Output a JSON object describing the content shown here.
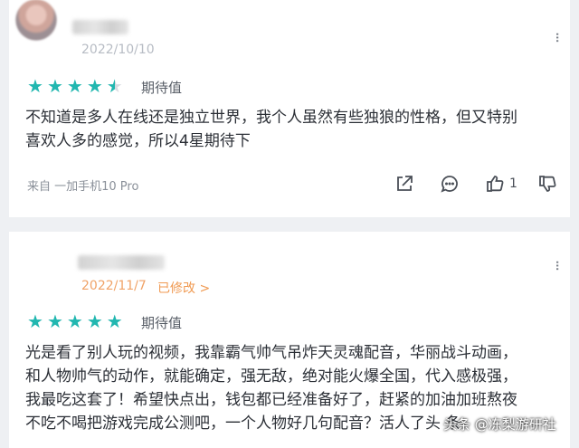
{
  "reviews": [
    {
      "date": "2022/10/10",
      "rating": 4.5,
      "rating_label": "期待值",
      "text_lines": [
        "不知道是多人在线还是独立世界，我个人虽然有些独狼的性格，但又特别",
        "喜欢人多的感觉，所以4星期待下"
      ],
      "device": "来自 一加手机10 Pro",
      "like_count": "1",
      "icons": [
        "share-icon",
        "comment-icon",
        "thumbs-up-icon",
        "thumbs-down-icon",
        "more-icon"
      ]
    },
    {
      "date": "2022/11/7",
      "edited_label": "已修改 >",
      "rating": 5,
      "rating_label": "期待值",
      "text_lines": [
        "光是看了别人玩的视频，我靠霸气帅气吊炸天灵魂配音，华丽战斗动画，",
        "和人物帅气的动作，就能确定，强无敌，绝对能火爆全国，代入感极强，",
        "我最吃这套了！希望快点出，钱包都已经准备好了，赶紧的加油加班熬夜",
        "不吃不喝把游戏完成公测吧，一个人物好几句配音？活人了头 条"
      ]
    }
  ],
  "watermark": "头条 @冻梨游研社",
  "colors": {
    "star": "#21b7b0",
    "edited": "#f09a52",
    "date": "#b7bcc4"
  }
}
